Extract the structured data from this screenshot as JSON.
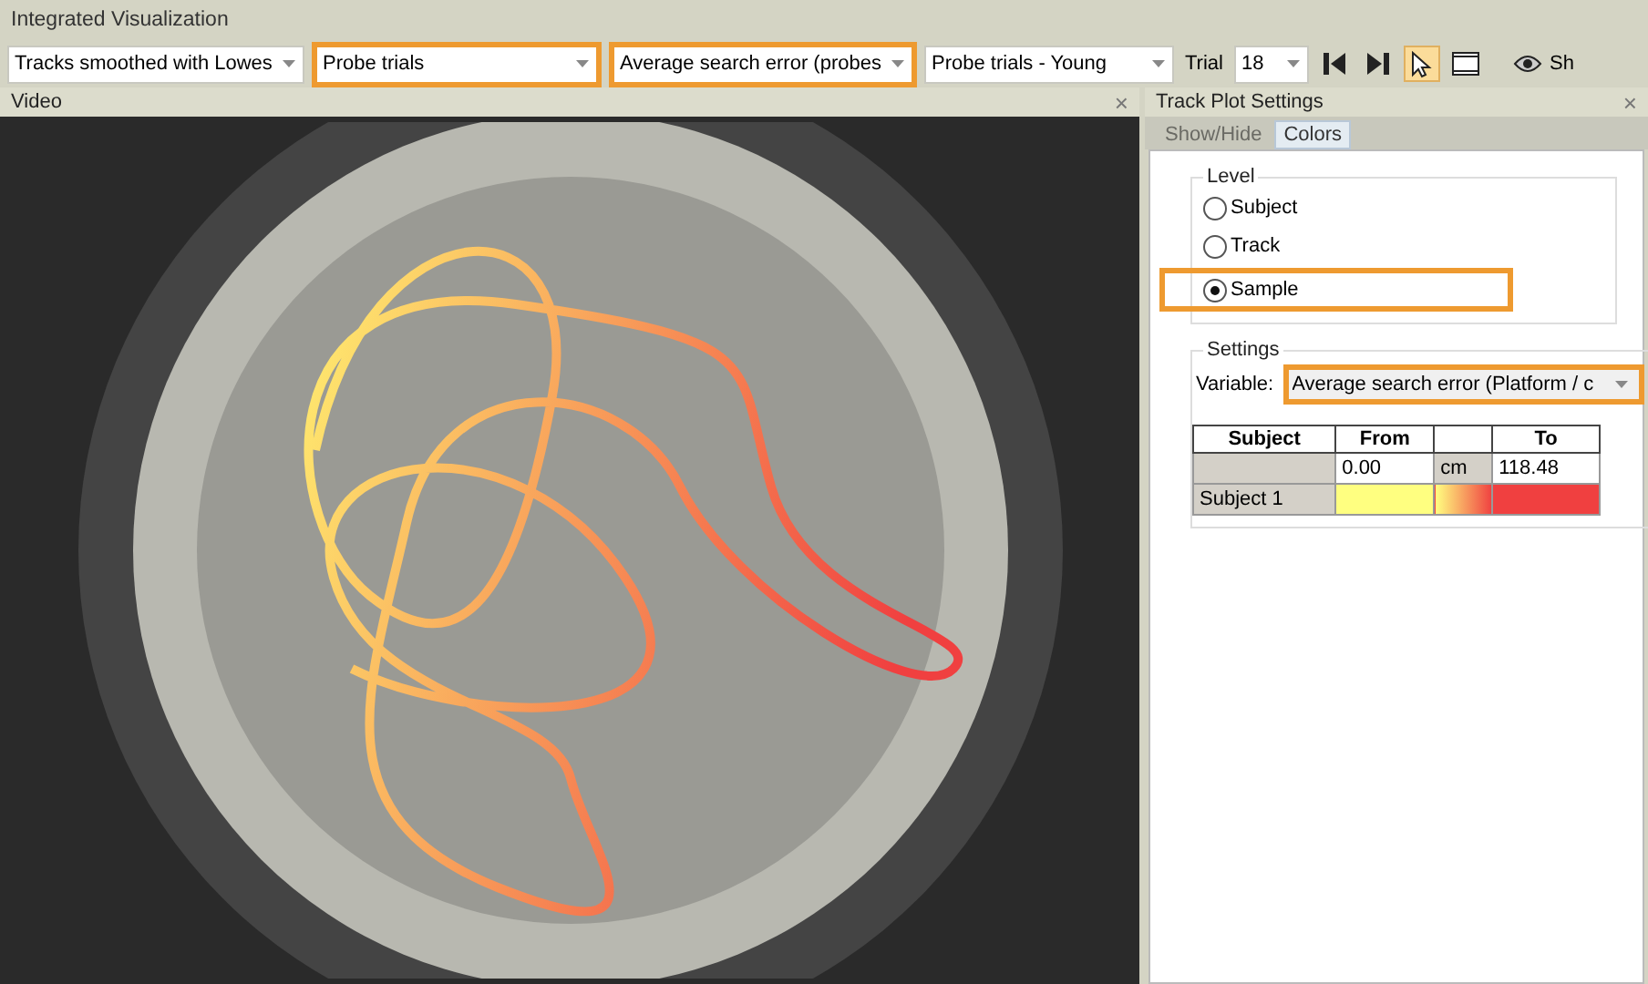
{
  "window": {
    "title": "Integrated Visualization"
  },
  "toolbar": {
    "combos": [
      {
        "value": "Tracks smoothed with Lowes",
        "highlighted": false
      },
      {
        "value": "Probe trials",
        "highlighted": true
      },
      {
        "value": "Average search error (probes",
        "highlighted": true
      },
      {
        "value": "Probe trials - Young",
        "highlighted": false
      }
    ],
    "trial_label": "Trial",
    "trial_value": "18",
    "tools": [
      {
        "kind": "first",
        "selected": false
      },
      {
        "kind": "last",
        "selected": false
      },
      {
        "kind": "pointer",
        "selected": true
      },
      {
        "kind": "film",
        "selected": false
      }
    ],
    "show_button": "Sh"
  },
  "video": {
    "title": "Video",
    "close": "×"
  },
  "settings_panel": {
    "title": "Track Plot Settings",
    "close": "×",
    "tabs": [
      {
        "label": "Show/Hide",
        "selected": false
      },
      {
        "label": "Colors",
        "selected": true
      }
    ],
    "level": {
      "title": "Level",
      "options": [
        {
          "label": "Subject",
          "selected": false,
          "highlighted": false
        },
        {
          "label": "Track",
          "selected": false,
          "highlighted": false
        },
        {
          "label": "Sample",
          "selected": true,
          "highlighted": true
        }
      ]
    },
    "settings": {
      "title": "Settings",
      "variable_label": "Variable:",
      "variable_value": "Average search error (Platform / c",
      "highlighted": true
    },
    "table": {
      "columns": [
        "Subject",
        "From",
        "",
        "To"
      ],
      "range_row": [
        "0.00",
        "cm",
        "118.48"
      ],
      "subject_row": {
        "name": "Subject 1"
      }
    }
  }
}
